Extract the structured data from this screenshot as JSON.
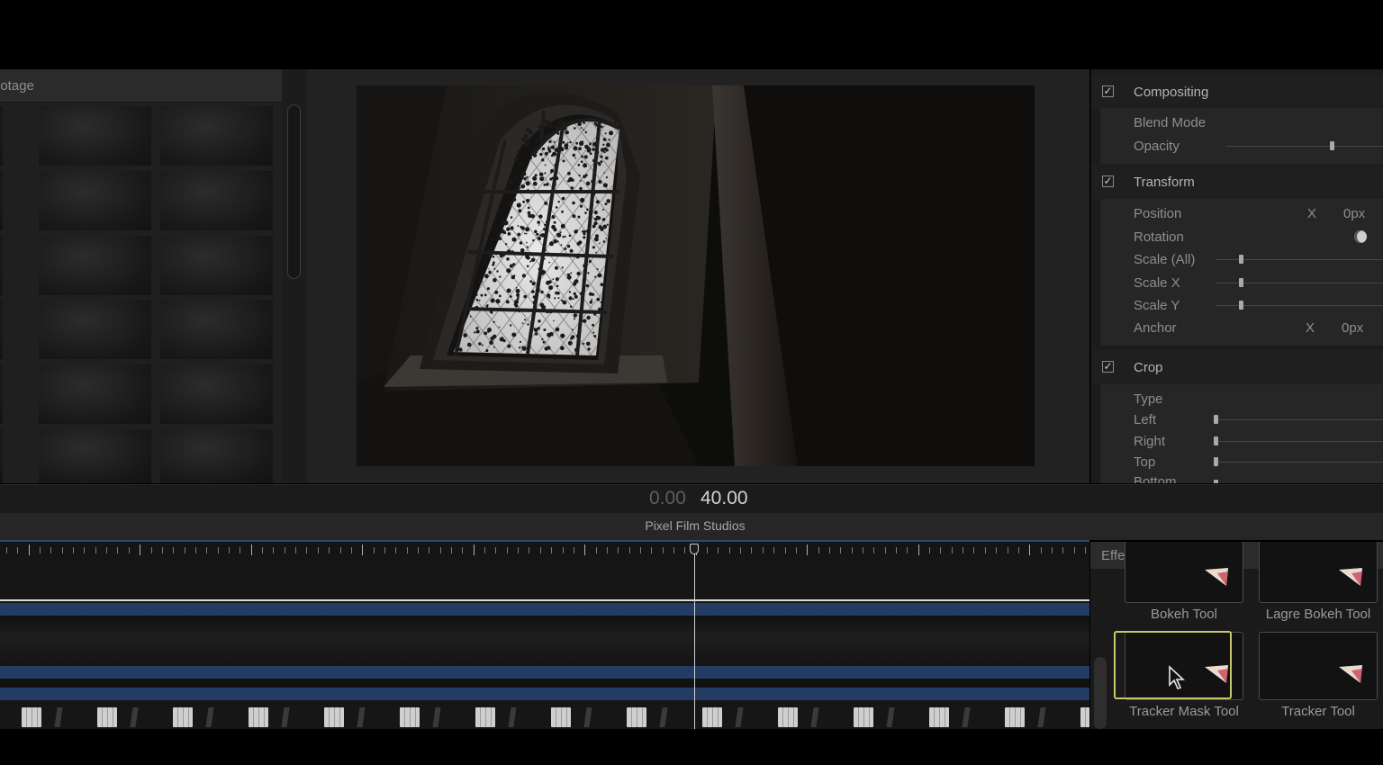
{
  "library": {
    "title": "ootage"
  },
  "viewer": {
    "clip": "cathedral-window-frame"
  },
  "inspector": {
    "compositing": {
      "title": "Compositing",
      "checked": true,
      "blend_mode_label": "Blend Mode",
      "opacity_label": "Opacity"
    },
    "transform": {
      "title": "Transform",
      "checked": true,
      "position_label": "Position",
      "position_axis": "X",
      "position_value": "0px",
      "rotation_label": "Rotation",
      "scale_all_label": "Scale (All)",
      "scale_x_label": "Scale X",
      "scale_y_label": "Scale Y",
      "anchor_label": "Anchor",
      "anchor_axis": "X",
      "anchor_value": "0px"
    },
    "crop": {
      "title": "Crop",
      "checked": true,
      "type_label": "Type",
      "left_label": "Left",
      "right_label": "Right",
      "top_label": "Top",
      "bottom_label": "Bottom"
    }
  },
  "timecode": {
    "start": "0.00",
    "end": "40.00"
  },
  "app": {
    "title": "Pixel Film Studios"
  },
  "effects": {
    "title": "Effects",
    "items": [
      {
        "label": "Bokeh Tool",
        "selected": false
      },
      {
        "label": "Lagre Bokeh Tool",
        "selected": false
      },
      {
        "label": "Tracker Mask Tool",
        "selected": true
      },
      {
        "label": "Tracker Tool",
        "selected": false
      }
    ]
  },
  "colors": {
    "timeline_track": "#233c63",
    "selection_outline": "#c8c86a",
    "ruler_accent": "#2a4a7a"
  },
  "icons": {
    "checkbox": "checkmark-icon",
    "rotation": "rotation-dial-icon",
    "effect": "effect-clapper-icon",
    "cursor": "mouse-pointer-icon"
  }
}
